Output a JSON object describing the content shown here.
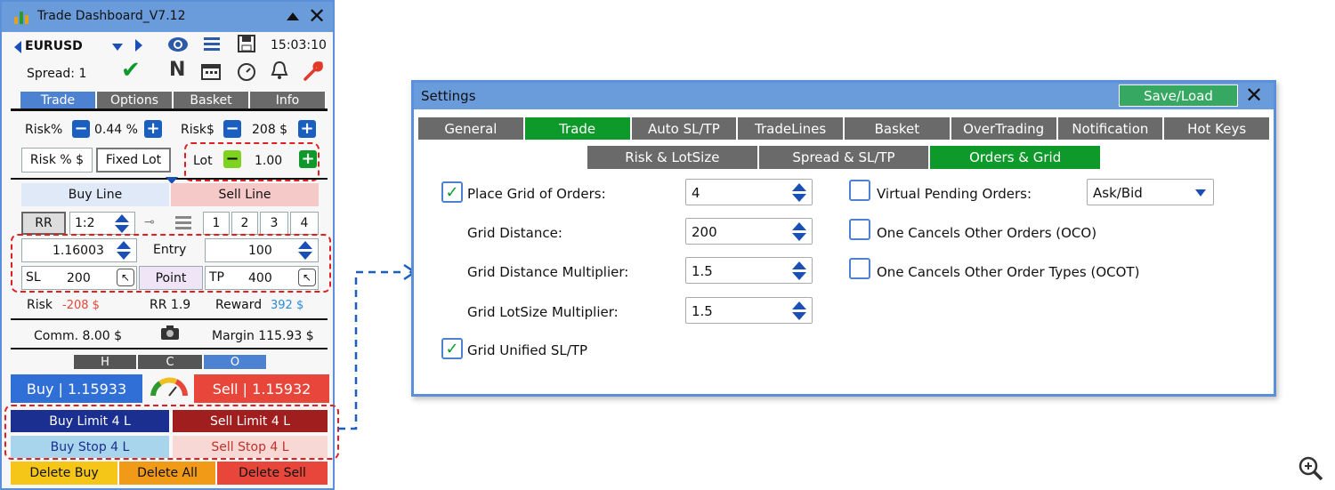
{
  "dashboard": {
    "title": "Trade Dashboard_V7.12",
    "symbol": "EURUSD",
    "time": "15:03:10",
    "spread": "Spread: 1",
    "tabs": [
      "Trade",
      "Options",
      "Basket",
      "Info"
    ],
    "risk_pct_label": "Risk%",
    "risk_pct_value": "0.44 %",
    "risk_usd_label": "Risk$",
    "risk_usd_value": "208 $",
    "risk_mode_btn": "Risk % $",
    "fixed_lot_btn": "Fixed Lot",
    "lot_label": "Lot",
    "lot_value": "1.00",
    "buy_line": "Buy Line",
    "sell_line": "Sell Line",
    "rr_label": "RR",
    "rr_value": "1:2",
    "presets": [
      "1",
      "2",
      "3",
      "4"
    ],
    "price": "1.16003",
    "entry_label": "Entry",
    "entry_value": "100",
    "sl_label": "SL",
    "sl_value": "200",
    "point_btn": "Point",
    "tp_label": "TP",
    "tp_value": "400",
    "risk_label": "Risk",
    "risk_amount": "-208 $",
    "rr_info": "RR 1.9",
    "reward_label": "Reward",
    "reward_amount": "392 $",
    "commission": "Comm. 8.00 $",
    "margin": "Margin 115.93 $",
    "hco": [
      "H",
      "C",
      "O"
    ],
    "buy_btn": "Buy | 1.15933",
    "sell_btn": "Sell | 1.15932",
    "buy_limit": "Buy Limit 4 L",
    "sell_limit": "Sell Limit 4 L",
    "buy_stop": "Buy Stop 4 L",
    "sell_stop": "Sell Stop 4 L",
    "delete_buy": "Delete Buy",
    "delete_all": "Delete All",
    "delete_sell": "Delete Sell"
  },
  "settings": {
    "title": "Settings",
    "save_load": "Save/Load",
    "tabs_row1": [
      {
        "label": "General",
        "active": false
      },
      {
        "label": "Trade",
        "active": true
      },
      {
        "label": "Auto SL/TP",
        "active": false
      },
      {
        "label": "TradeLines",
        "active": false
      },
      {
        "label": "Basket",
        "active": false
      },
      {
        "label": "OverTrading",
        "active": false
      },
      {
        "label": "Notification",
        "active": false
      },
      {
        "label": "Hot Keys",
        "active": false
      }
    ],
    "tabs_row2": [
      {
        "label": "Risk & LotSize",
        "active": false
      },
      {
        "label": "Spread & SL/TP",
        "active": false
      },
      {
        "label": "Orders & Grid",
        "active": true
      }
    ],
    "place_grid": {
      "label": "Place Grid of Orders:",
      "checked": true,
      "value": "4"
    },
    "grid_distance": {
      "label": "Grid Distance:",
      "value": "200"
    },
    "grid_distance_mult": {
      "label": "Grid Distance Multiplier:",
      "value": "1.5"
    },
    "grid_lotsize_mult": {
      "label": "Grid LotSize Multiplier:",
      "value": "1.5"
    },
    "grid_unified": {
      "label": "Grid Unified SL/TP",
      "checked": true
    },
    "virtual_pending": {
      "label": "Virtual Pending Orders:",
      "checked": false,
      "value": "Ask/Bid"
    },
    "oco": {
      "label": "One Cancels Other Orders (OCO)",
      "checked": false
    },
    "ocot": {
      "label": "One Cancels Other Order Types (OCOT)",
      "checked": false
    }
  },
  "colors": {
    "accent_blue": "#4d82d2",
    "active_green": "#0e9a2a",
    "buy_blue": "#2f6fd6",
    "sell_red": "#e8463a",
    "dashed_red": "#e02020"
  }
}
